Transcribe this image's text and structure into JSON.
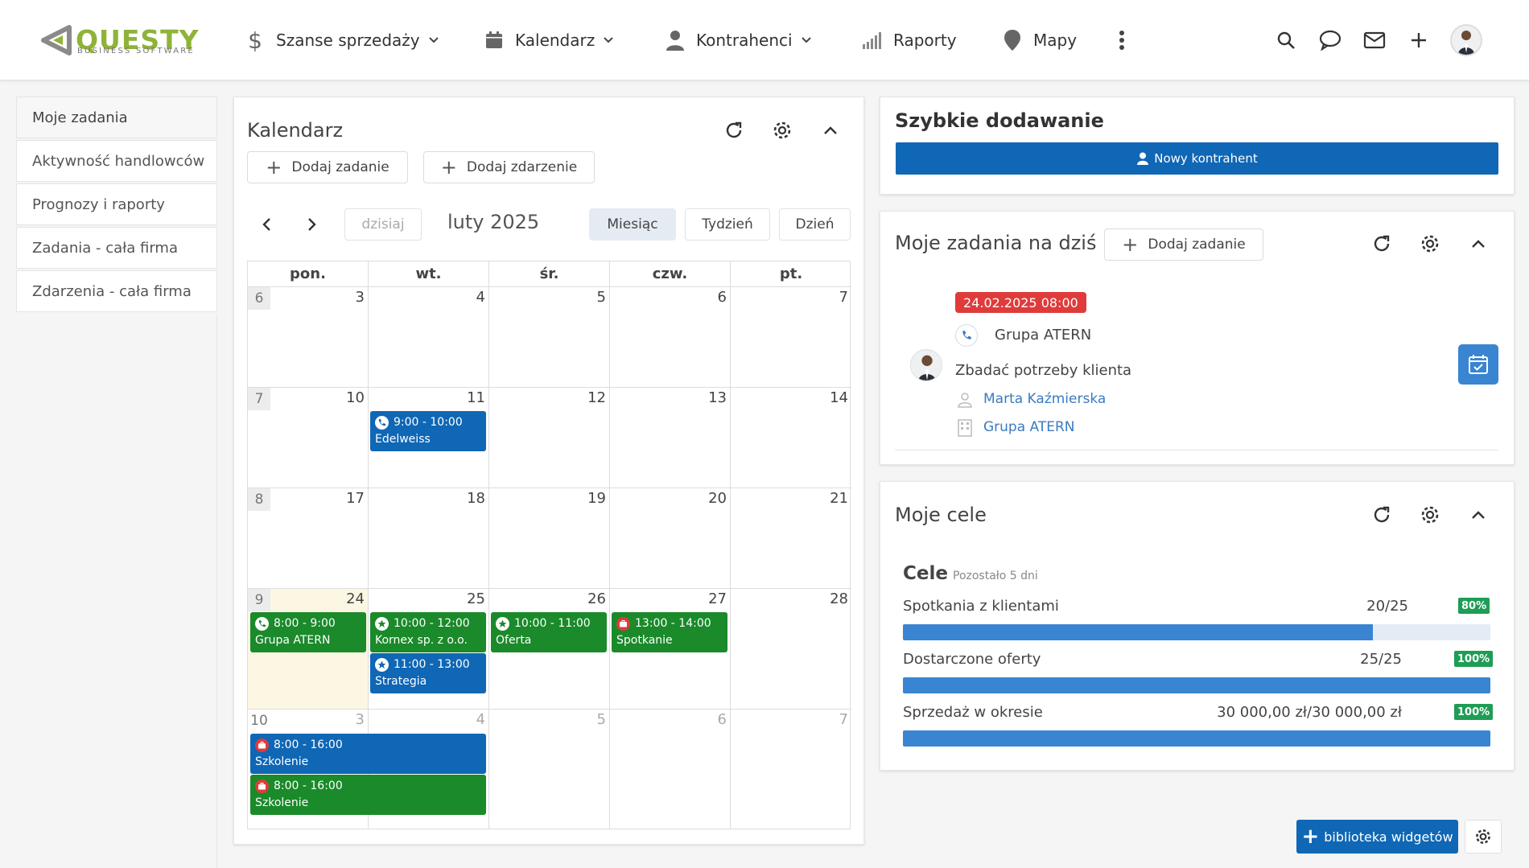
{
  "header": {
    "logo_text": "QUESTY",
    "logo_sub": "BUSINESS SOFTWARE",
    "nav": [
      {
        "label": "Szanse sprzedaży",
        "icon": "dollar-icon"
      },
      {
        "label": "Kalendarz",
        "icon": "calendar-icon"
      },
      {
        "label": "Kontrahenci",
        "icon": "person-icon"
      },
      {
        "label": "Raporty",
        "icon": "bar-chart-icon"
      },
      {
        "label": "Mapy",
        "icon": "map-pin-icon"
      }
    ]
  },
  "sidebar": {
    "items": [
      {
        "label": "Moje zadania"
      },
      {
        "label": "Aktywność handlowców"
      },
      {
        "label": "Prognozy i raporty"
      },
      {
        "label": "Zadania - cała firma"
      },
      {
        "label": "Zdarzenia - cała firma"
      }
    ]
  },
  "calendar": {
    "title": "Kalendarz",
    "add_task": "Dodaj zadanie",
    "add_event": "Dodaj zdarzenie",
    "today": "dzisiaj",
    "month": "luty 2025",
    "views": [
      "Miesiąc",
      "Tydzień",
      "Dzień"
    ],
    "days": [
      "pon.",
      "wt.",
      "śr.",
      "czw.",
      "pt."
    ],
    "weeks": [
      {
        "num": "6",
        "days": [
          "3",
          "4",
          "5",
          "6",
          "7"
        ]
      },
      {
        "num": "7",
        "days": [
          "10",
          "11",
          "12",
          "13",
          "14"
        ]
      },
      {
        "num": "8",
        "days": [
          "17",
          "18",
          "19",
          "20",
          "21"
        ]
      },
      {
        "num": "9",
        "days": [
          "24",
          "25",
          "26",
          "27",
          "28"
        ]
      },
      {
        "num": "10",
        "days": [
          "3",
          "4",
          "5",
          "6",
          "7"
        ]
      }
    ],
    "events": [
      {
        "time": "9:00 - 10:00",
        "name": "Edelweiss"
      },
      {
        "time": "8:00 - 9:00",
        "name": "Grupa ATERN"
      },
      {
        "time": "10:00 - 12:00",
        "name": "Kornex sp. z o.o."
      },
      {
        "time": "11:00 - 13:00",
        "name": "Strategia"
      },
      {
        "time": "10:00 - 11:00",
        "name": "Oferta"
      },
      {
        "time": "13:00 - 14:00",
        "name": "Spotkanie"
      },
      {
        "time": "8:00 - 16:00",
        "name": "Szkolenie"
      },
      {
        "time": "8:00 - 16:00",
        "name": "Szkolenie"
      }
    ]
  },
  "quick_add": {
    "title": "Szybkie dodawanie",
    "new_contractor": "Nowy kontrahent"
  },
  "tasks": {
    "title": "Moje zadania na dziś",
    "add_task": "Dodaj zadanie",
    "date": "24.02.2025 08:00",
    "company": "Grupa ATERN",
    "description": "Zbadać potrzeby klienta",
    "person": "Marta Kaźmierska",
    "company_link": "Grupa ATERN"
  },
  "goals": {
    "title": "Moje cele",
    "section": "Cele",
    "remaining": "Pozostało 5 dni",
    "items": [
      {
        "label": "Spotkania z klientami",
        "value": "20/25",
        "pct": "80%",
        "fill": 80
      },
      {
        "label": "Dostarczone oferty",
        "value": "25/25",
        "pct": "100%",
        "fill": 100
      },
      {
        "label": "Sprzedaż w okresie",
        "value": "30 000,00 zł/30 000,00 zł",
        "pct": "100%",
        "fill": 100
      }
    ]
  },
  "footer": {
    "widget_library": "biblioteka widgetów"
  },
  "colors": {
    "brand_green": "#8fb339",
    "primary_blue": "#0f67b5",
    "event_green": "#1a8a2a",
    "badge_red": "#e03b3b",
    "progress_blue": "#3a85d1"
  }
}
